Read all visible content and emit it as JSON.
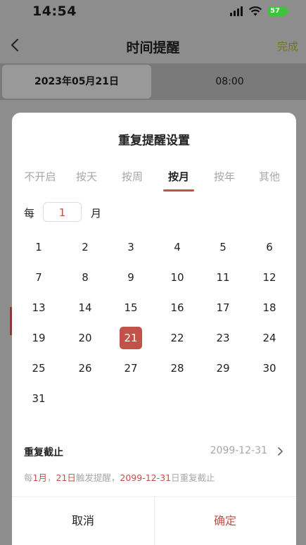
{
  "status": {
    "time": "14:54",
    "battery": "57"
  },
  "nav": {
    "title": "时间提醒",
    "done_label": "完成"
  },
  "segment": {
    "date": "2023年05月21日",
    "time": "08:00"
  },
  "dialog": {
    "title": "重复提醒设置",
    "tabs": [
      "不开启",
      "按天",
      "按周",
      "按月",
      "按年",
      "其他"
    ],
    "active_tab": "按月",
    "every_prefix": "每",
    "every_value": "1",
    "every_unit": "月",
    "days": [
      "1",
      "2",
      "3",
      "4",
      "5",
      "6",
      "7",
      "8",
      "9",
      "10",
      "11",
      "12",
      "13",
      "14",
      "15",
      "16",
      "17",
      "18",
      "19",
      "20",
      "21",
      "22",
      "23",
      "24",
      "25",
      "26",
      "27",
      "28",
      "29",
      "30",
      "31"
    ],
    "selected_day": "21",
    "end": {
      "label": "重复截止",
      "value": "2099-12-31"
    },
    "summary": {
      "p1": "每",
      "v1": "1月",
      "p2": "，",
      "v2": "21日",
      "p3": "触发提醒，",
      "v3": "2099-12-31",
      "p4": "日重复截止"
    },
    "cancel_label": "取消",
    "confirm_label": "确定"
  },
  "colors": {
    "accent": "#c0524a",
    "done": "#73751c",
    "battery": "#3ec43a"
  },
  "icons": {
    "back": "chevron-left-icon",
    "end": "chevron-right-icon",
    "wifi": "wifi-icon",
    "signal": "signal-icon",
    "battery": "battery-icon"
  }
}
